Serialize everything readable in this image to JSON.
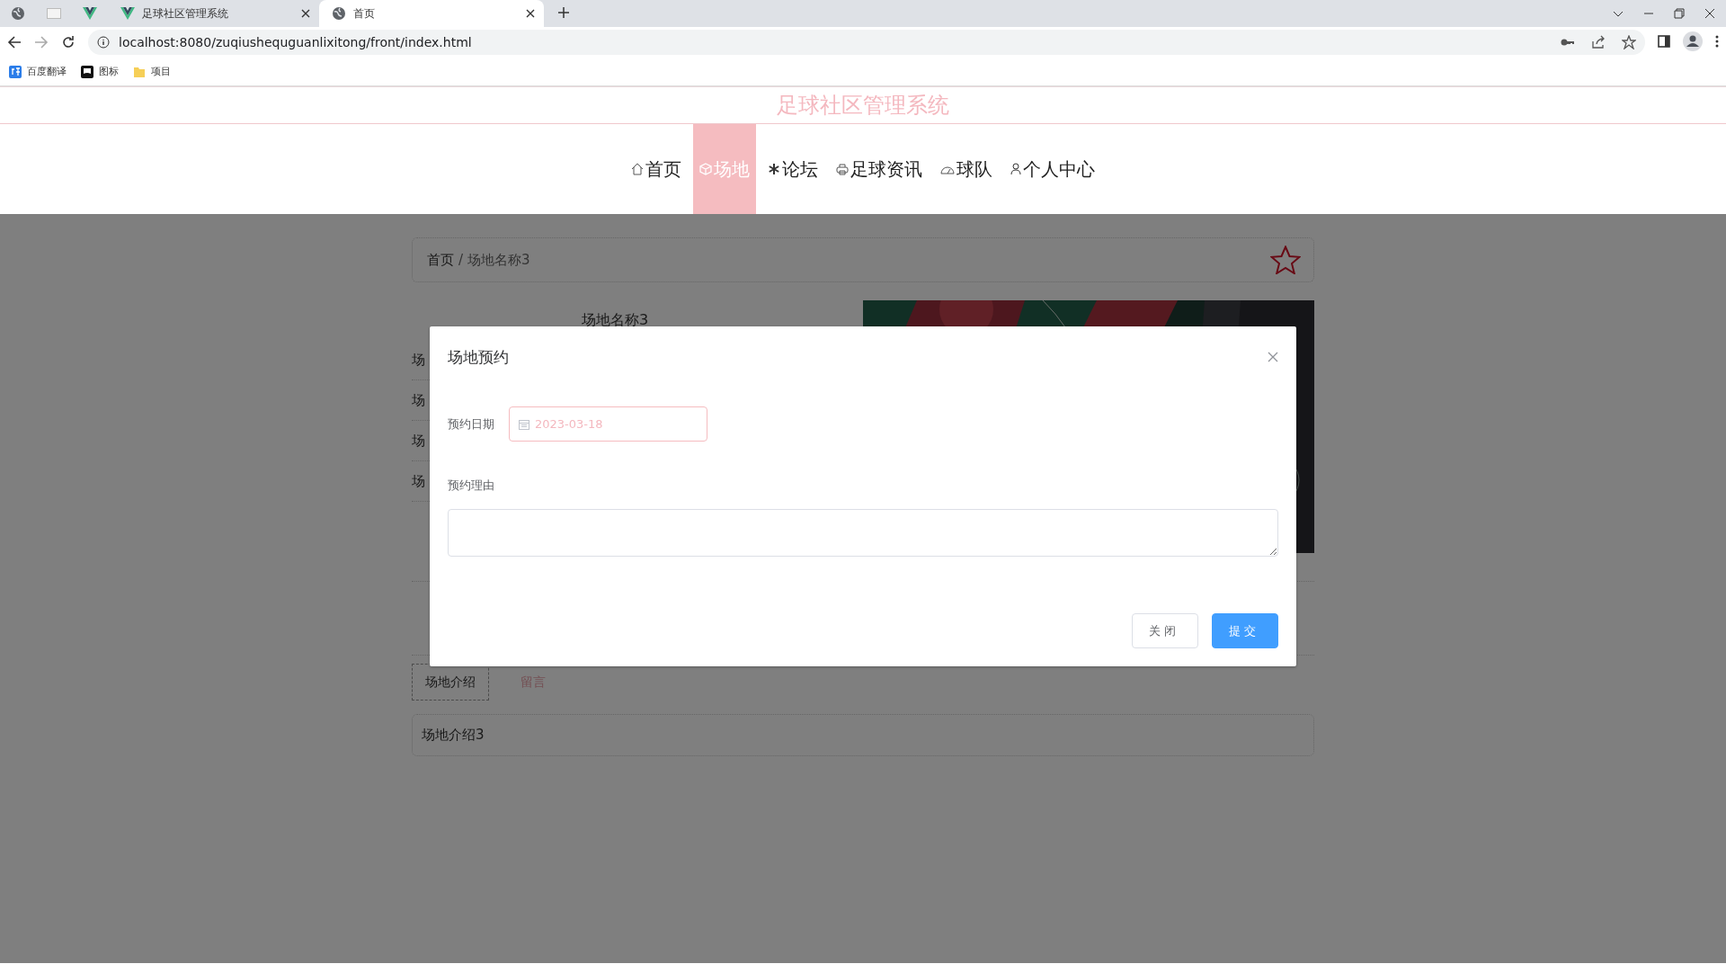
{
  "browser": {
    "tabs": [
      {
        "title": "足球社区管理系统",
        "kind": "vue",
        "selected": false
      },
      {
        "title": "首页",
        "kind": "globe",
        "selected": true
      }
    ],
    "address": "localhost:8080/zuqiushequguanlixitong/front/index.html",
    "bookmarks": [
      {
        "label": "百度翻译",
        "kind": "translate"
      },
      {
        "label": "图标",
        "kind": "flag"
      },
      {
        "label": "项目",
        "kind": "folder"
      }
    ]
  },
  "site_title": "足球社区管理系统",
  "nav": [
    {
      "label": "首页",
      "kind": "home",
      "selected": false
    },
    {
      "label": "场地",
      "kind": "cube",
      "selected": true
    },
    {
      "label": "论坛",
      "kind": "snow",
      "selected": false
    },
    {
      "label": "足球资讯",
      "kind": "print",
      "selected": false
    },
    {
      "label": "球队",
      "kind": "gauge",
      "selected": false
    },
    {
      "label": "个人中心",
      "kind": "user",
      "selected": false
    }
  ],
  "breadcrumb": {
    "home": "首页",
    "separator": "/",
    "current": "场地名称3"
  },
  "venue": {
    "name": "场地名称3",
    "fields": [
      "场",
      "场",
      "场",
      "场"
    ]
  },
  "detail_tabs": [
    {
      "label": "场地介绍",
      "selected": true
    },
    {
      "label": "留言",
      "selected": false
    }
  ],
  "intro": "场地介绍3",
  "dialog": {
    "title": "场地预约",
    "fields": [
      {
        "kind": "date",
        "label": "预约日期",
        "value": "2023-03-18"
      },
      {
        "kind": "textarea",
        "label": "预约理由"
      }
    ],
    "buttons": [
      {
        "label": "关闭",
        "kind": "default"
      },
      {
        "label": "提交",
        "kind": "primary"
      }
    ]
  }
}
